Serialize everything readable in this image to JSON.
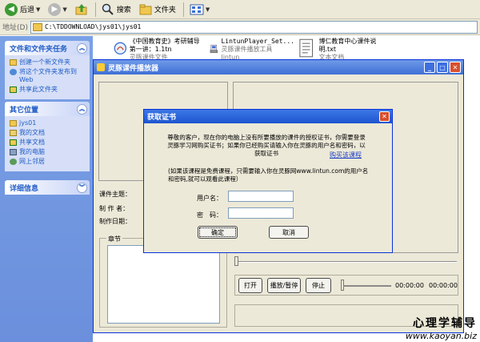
{
  "toolbar": {
    "back_label": "后退",
    "search_label": "搜索",
    "folders_label": "文件夹"
  },
  "address": {
    "label": "地址(D)",
    "value": "C:\\TDDOWNLOAD\\jys01\\jys01"
  },
  "leftpane": {
    "tasks_header": "文件和文件夹任务",
    "tasks": [
      {
        "label": "创建一个新文件夹",
        "icon": "new-folder-icon"
      },
      {
        "label": "将这个文件夹发布到 Web",
        "icon": "web-publish-icon"
      },
      {
        "label": "共享此文件夹",
        "icon": "share-folder-icon"
      }
    ],
    "places_header": "其它位置",
    "places": [
      {
        "label": "jys01",
        "icon": "folder-icon"
      },
      {
        "label": "我的文档",
        "icon": "my-documents-icon"
      },
      {
        "label": "共享文档",
        "icon": "shared-documents-icon"
      },
      {
        "label": "我的电脑",
        "icon": "my-computer-icon"
      },
      {
        "label": "网上邻居",
        "icon": "network-icon"
      }
    ],
    "details_header": "详细信息"
  },
  "files": [
    {
      "name": "《中国教育史》考研辅导第一讲：1.1tn",
      "sub": "灵豚课件文件",
      "icon": "lingtun-course-icon"
    },
    {
      "name": "LintunPlayer_Set...",
      "sub": "灵豚课件播放工具",
      "sub2": "lintun",
      "icon": "installer-icon"
    },
    {
      "name": "博仁教育中心课件说明.txt",
      "sub": "文本文档",
      "icon": "text-file-icon"
    }
  ],
  "player": {
    "title": "灵豚课件播放器",
    "course_topic_label": "课件主题：",
    "author_label": "制 作 者：",
    "date_label": "制作日期：",
    "chapter_label": "章节",
    "play_label": "打开",
    "pause_label": "播放/暂停",
    "stop_label": "停止",
    "time_current": "00:00:00",
    "time_total": "00:00:00"
  },
  "dialog": {
    "title": "获取证书",
    "message": "尊敬的客户，现在你的电脑上没有所要播放的课件的授权证书，你需要登录灵豚学习网购买证书；如果你已经购买请输入你在灵豚的用户名和密码，以获取证书",
    "buy_link": "购买该课程",
    "note": "(如果该课程是免费课程，只需要输入你在灵豚网www.lintun.com的用户名和密码,就可以观看此课程）",
    "username_label": "用户名：",
    "password_label": "密　码：",
    "ok_label": "确定",
    "cancel_label": "取消"
  },
  "watermark": {
    "line1": "心理学辅导",
    "line2": "www.kaoyan.biz"
  }
}
